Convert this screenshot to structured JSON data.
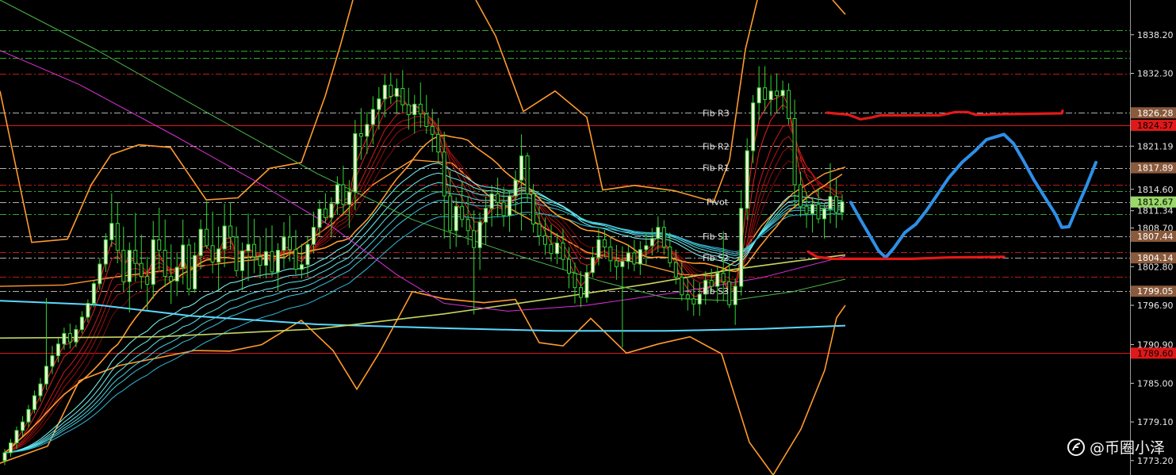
{
  "chart_data": {
    "type": "line",
    "title": "",
    "ylim": [
      1771.0,
      1843.5
    ],
    "y_ticks": [
      "1838.20",
      "1832.30",
      "1826.28",
      "1824.37",
      "1821.19",
      "1817.89",
      "1814.60",
      "1812.67",
      "1811.34",
      "1808.70",
      "1807.44",
      "1804.14",
      "1802.80",
      "1799.05",
      "1796.90",
      "1790.90",
      "1789.60",
      "1785.00",
      "1779.10",
      "1773.20"
    ],
    "price_tags": [
      {
        "label": "1826.28",
        "value": 1826.28,
        "bg": "#8a5a3c",
        "fg": "#ffffff"
      },
      {
        "label": "1824.37",
        "value": 1824.37,
        "bg": "#e01818",
        "fg": "#000000"
      },
      {
        "label": "1817.89",
        "value": 1817.89,
        "bg": "#8a5a3c",
        "fg": "#ffffff"
      },
      {
        "label": "1812.67",
        "value": 1812.67,
        "bg": "#9ad86a",
        "fg": "#000000"
      },
      {
        "label": "1807.44",
        "value": 1807.44,
        "bg": "#8a5a3c",
        "fg": "#ffffff"
      },
      {
        "label": "1804.14",
        "value": 1804.14,
        "bg": "#8a5a3c",
        "fg": "#ffffff"
      },
      {
        "label": "1799.05",
        "value": 1799.05,
        "bg": "#8a5a3c",
        "fg": "#ffffff"
      },
      {
        "label": "1789.60",
        "value": 1789.6,
        "bg": "#e01818",
        "fg": "#000000"
      }
    ],
    "fib_levels": [
      {
        "name": "Fib R3",
        "value": 1826.28
      },
      {
        "name": "Fib R2",
        "value": 1821.19
      },
      {
        "name": "Fib R1",
        "value": 1817.89
      },
      {
        "name": "Pivot",
        "value": 1812.67
      },
      {
        "name": "Fib S1",
        "value": 1807.44
      },
      {
        "name": "Fib S2",
        "value": 1804.14
      },
      {
        "name": "Fib S3",
        "value": 1799.05
      }
    ],
    "horizontal_lines": [
      {
        "value": 1838.9,
        "color": "#2fa82f",
        "style": "dashdot"
      },
      {
        "value": 1835.8,
        "color": "#2fa82f",
        "style": "dashdot"
      },
      {
        "value": 1834.7,
        "color": "#2fa82f",
        "style": "dashdot"
      },
      {
        "value": 1832.3,
        "color": "#c21a1a",
        "style": "dashdot"
      },
      {
        "value": 1826.28,
        "color": "#b0b0b0",
        "style": "dashdot"
      },
      {
        "value": 1824.37,
        "color": "#e01818",
        "style": "solid"
      },
      {
        "value": 1821.19,
        "color": "#b0b0b0",
        "style": "dashdot"
      },
      {
        "value": 1817.89,
        "color": "#b0b0b0",
        "style": "dashdot"
      },
      {
        "value": 1815.3,
        "color": "#c21a1a",
        "style": "dashdot"
      },
      {
        "value": 1814.3,
        "color": "#2fa82f",
        "style": "dashdot"
      },
      {
        "value": 1812.67,
        "color": "#b0b0b0",
        "style": "dashdot"
      },
      {
        "value": 1810.8,
        "color": "#2fa82f",
        "style": "dashdot"
      },
      {
        "value": 1807.44,
        "color": "#b0b0b0",
        "style": "dashdot"
      },
      {
        "value": 1805.0,
        "color": "#c21a1a",
        "style": "dashdot"
      },
      {
        "value": 1804.14,
        "color": "#b0b0b0",
        "style": "dashdot"
      },
      {
        "value": 1801.3,
        "color": "#c21a1a",
        "style": "dashdot"
      },
      {
        "value": 1799.05,
        "color": "#b0b0b0",
        "style": "dashdot"
      },
      {
        "value": 1789.6,
        "color": "#e01818",
        "style": "solid"
      }
    ],
    "candles": [
      [
        1773.2,
        1775.0,
        1772.5,
        1774.4
      ],
      [
        1774.4,
        1776.5,
        1773.8,
        1775.9
      ],
      [
        1775.9,
        1778.4,
        1775.0,
        1777.8
      ],
      [
        1777.8,
        1780.0,
        1776.9,
        1779.1
      ],
      [
        1779.1,
        1781.7,
        1778.3,
        1781.0
      ],
      [
        1781.0,
        1783.9,
        1780.4,
        1783.1
      ],
      [
        1783.1,
        1785.8,
        1782.2,
        1784.9
      ],
      [
        1784.9,
        1798.0,
        1784.0,
        1787.6
      ],
      [
        1787.6,
        1790.7,
        1786.4,
        1789.2
      ],
      [
        1789.2,
        1791.9,
        1788.2,
        1791.0
      ],
      [
        1791.0,
        1793.5,
        1790.1,
        1792.6
      ],
      [
        1792.6,
        1794.1,
        1790.3,
        1791.3
      ],
      [
        1791.3,
        1793.9,
        1790.5,
        1793.2
      ],
      [
        1793.2,
        1796.0,
        1792.6,
        1795.1
      ],
      [
        1795.1,
        1797.8,
        1794.3,
        1797.2
      ],
      [
        1797.2,
        1800.7,
        1796.6,
        1800.2
      ],
      [
        1800.2,
        1804.1,
        1799.3,
        1803.2
      ],
      [
        1803.2,
        1807.9,
        1802.0,
        1806.9
      ],
      [
        1806.9,
        1814.0,
        1805.8,
        1809.4
      ],
      [
        1809.4,
        1812.6,
        1803.3,
        1805.3
      ],
      [
        1805.3,
        1808.9,
        1799.0,
        1800.5
      ],
      [
        1800.5,
        1806.5,
        1795.8,
        1805.3
      ],
      [
        1805.3,
        1811.0,
        1800.5,
        1803.3
      ],
      [
        1803.3,
        1807.7,
        1799.4,
        1801.3
      ],
      [
        1801.3,
        1804.3,
        1796.2,
        1800.1
      ],
      [
        1800.1,
        1809.8,
        1797.9,
        1806.9
      ],
      [
        1806.9,
        1811.8,
        1802.3,
        1805.3
      ],
      [
        1805.3,
        1810.0,
        1799.7,
        1801.3
      ],
      [
        1801.3,
        1806.2,
        1797.1,
        1800.6
      ],
      [
        1800.6,
        1805.0,
        1798.3,
        1802.7
      ],
      [
        1802.7,
        1810.0,
        1800.1,
        1806.1
      ],
      [
        1806.1,
        1807.1,
        1798.4,
        1799.4
      ],
      [
        1799.4,
        1806.5,
        1798.8,
        1804.5
      ],
      [
        1804.5,
        1810.0,
        1802.4,
        1808.5
      ],
      [
        1808.5,
        1812.8,
        1805.5,
        1806.0
      ],
      [
        1806.0,
        1811.2,
        1801.8,
        1803.5
      ],
      [
        1803.5,
        1808.9,
        1799.0,
        1805.5
      ],
      [
        1805.5,
        1812.4,
        1802.7,
        1809.0
      ],
      [
        1809.0,
        1812.6,
        1805.4,
        1807.3
      ],
      [
        1807.3,
        1808.9,
        1801.3,
        1802.2
      ],
      [
        1802.2,
        1806.5,
        1799.2,
        1805.2
      ],
      [
        1805.2,
        1810.9,
        1800.6,
        1806.2
      ],
      [
        1806.2,
        1810.1,
        1801.8,
        1804.3
      ],
      [
        1804.3,
        1807.3,
        1801.0,
        1803.0
      ],
      [
        1803.0,
        1808.7,
        1801.0,
        1805.1
      ],
      [
        1805.1,
        1809.1,
        1801.3,
        1802.0
      ],
      [
        1802.0,
        1806.4,
        1799.0,
        1805.3
      ],
      [
        1805.3,
        1809.6,
        1802.5,
        1807.3
      ],
      [
        1807.3,
        1810.6,
        1803.6,
        1805.4
      ],
      [
        1805.4,
        1808.4,
        1801.6,
        1802.4
      ],
      [
        1802.4,
        1806.3,
        1801.0,
        1803.1
      ],
      [
        1803.1,
        1807.5,
        1801.2,
        1806.2
      ],
      [
        1806.2,
        1811.2,
        1804.8,
        1808.8
      ],
      [
        1808.8,
        1813.0,
        1807.4,
        1811.6
      ],
      [
        1811.6,
        1814.0,
        1809.4,
        1810.3
      ],
      [
        1810.3,
        1813.4,
        1807.4,
        1812.4
      ],
      [
        1812.4,
        1816.6,
        1810.7,
        1815.3
      ],
      [
        1815.3,
        1818.2,
        1810.8,
        1812.3
      ],
      [
        1812.3,
        1816.0,
        1808.7,
        1814.2
      ],
      [
        1814.2,
        1825.2,
        1811.4,
        1823.1
      ],
      [
        1823.1,
        1827.0,
        1819.1,
        1822.7
      ],
      [
        1822.7,
        1826.4,
        1820.0,
        1824.5
      ],
      [
        1824.5,
        1828.8,
        1821.5,
        1826.8
      ],
      [
        1826.8,
        1830.2,
        1823.7,
        1828.4
      ],
      [
        1828.4,
        1832.1,
        1825.6,
        1830.5
      ],
      [
        1830.5,
        1832.4,
        1827.6,
        1828.8
      ],
      [
        1828.8,
        1831.5,
        1826.1,
        1830.0
      ],
      [
        1830.0,
        1832.8,
        1826.4,
        1827.5
      ],
      [
        1827.5,
        1830.1,
        1823.7,
        1826.0
      ],
      [
        1826.0,
        1829.0,
        1823.1,
        1827.6
      ],
      [
        1827.6,
        1830.9,
        1824.0,
        1826.1
      ],
      [
        1826.1,
        1829.0,
        1823.1,
        1824.2
      ],
      [
        1824.2,
        1826.9,
        1820.3,
        1823.0
      ],
      [
        1823.0,
        1825.5,
        1818.8,
        1820.3
      ],
      [
        1820.3,
        1823.4,
        1807.1,
        1813.6
      ],
      [
        1813.6,
        1817.4,
        1805.5,
        1808.3
      ],
      [
        1808.3,
        1813.4,
        1805.8,
        1812.0
      ],
      [
        1812.0,
        1815.8,
        1808.8,
        1810.0
      ],
      [
        1810.0,
        1813.6,
        1806.1,
        1808.3
      ],
      [
        1808.3,
        1811.4,
        1795.5,
        1805.7
      ],
      [
        1805.7,
        1811.1,
        1802.3,
        1809.6
      ],
      [
        1809.6,
        1813.5,
        1806.1,
        1811.7
      ],
      [
        1811.7,
        1815.2,
        1808.9,
        1813.9
      ],
      [
        1813.9,
        1816.4,
        1810.3,
        1812.6
      ],
      [
        1812.6,
        1815.0,
        1808.9,
        1810.6
      ],
      [
        1810.6,
        1814.5,
        1808.1,
        1813.6
      ],
      [
        1813.6,
        1817.5,
        1810.9,
        1816.0
      ],
      [
        1816.0,
        1823.0,
        1808.3,
        1819.7
      ],
      [
        1819.7,
        1820.2,
        1812.6,
        1813.9
      ],
      [
        1813.9,
        1815.4,
        1808.0,
        1809.3
      ],
      [
        1809.3,
        1812.0,
        1806.0,
        1807.5
      ],
      [
        1807.5,
        1810.3,
        1804.6,
        1806.2
      ],
      [
        1806.2,
        1809.2,
        1803.6,
        1804.8
      ],
      [
        1804.8,
        1807.9,
        1803.2,
        1806.4
      ],
      [
        1806.4,
        1808.6,
        1802.3,
        1803.9
      ],
      [
        1803.9,
        1805.8,
        1799.5,
        1801.8
      ],
      [
        1801.8,
        1803.4,
        1797.2,
        1799.6
      ],
      [
        1799.6,
        1802.1,
        1796.6,
        1798.1
      ],
      [
        1798.1,
        1803.1,
        1797.3,
        1801.9
      ],
      [
        1801.9,
        1805.8,
        1801.2,
        1804.2
      ],
      [
        1804.2,
        1808.6,
        1803.0,
        1806.9
      ],
      [
        1806.9,
        1808.4,
        1804.2,
        1805.8
      ],
      [
        1805.8,
        1807.3,
        1802.0,
        1803.7
      ],
      [
        1803.7,
        1806.1,
        1800.8,
        1802.8
      ],
      [
        1802.8,
        1805.9,
        1790.5,
        1803.6
      ],
      [
        1803.6,
        1806.2,
        1802.4,
        1804.9
      ],
      [
        1804.9,
        1806.9,
        1802.1,
        1803.2
      ],
      [
        1803.2,
        1806.7,
        1801.5,
        1805.4
      ],
      [
        1805.4,
        1808.0,
        1803.0,
        1806.0
      ],
      [
        1806.0,
        1808.7,
        1804.5,
        1807.1
      ],
      [
        1807.1,
        1810.5,
        1805.0,
        1808.8
      ],
      [
        1808.8,
        1809.9,
        1804.6,
        1805.8
      ],
      [
        1805.8,
        1808.0,
        1802.7,
        1803.4
      ],
      [
        1803.4,
        1805.4,
        1800.1,
        1801.2
      ],
      [
        1801.2,
        1803.6,
        1797.6,
        1798.5
      ],
      [
        1798.5,
        1801.0,
        1796.1,
        1797.9
      ],
      [
        1797.9,
        1800.8,
        1795.3,
        1797.1
      ],
      [
        1797.1,
        1800.3,
        1795.3,
        1798.6
      ],
      [
        1798.6,
        1802.1,
        1797.0,
        1800.7
      ],
      [
        1800.7,
        1802.5,
        1798.9,
        1799.8
      ],
      [
        1799.8,
        1803.0,
        1797.3,
        1801.8
      ],
      [
        1801.8,
        1808.2,
        1797.6,
        1800.5
      ],
      [
        1800.5,
        1803.3,
        1796.5,
        1797.0
      ],
      [
        1797.0,
        1801.0,
        1793.9,
        1799.8
      ],
      [
        1799.8,
        1814.5,
        1798.4,
        1811.7
      ],
      [
        1811.7,
        1822.4,
        1809.9,
        1820.5
      ],
      [
        1820.5,
        1829.0,
        1818.6,
        1827.8
      ],
      [
        1827.8,
        1833.4,
        1825.2,
        1830.1
      ],
      [
        1830.1,
        1833.4,
        1826.5,
        1828.3
      ],
      [
        1828.3,
        1832.0,
        1825.8,
        1829.6
      ],
      [
        1829.6,
        1832.3,
        1826.3,
        1828.9
      ],
      [
        1828.9,
        1831.2,
        1826.7,
        1829.7
      ],
      [
        1829.7,
        1830.8,
        1824.5,
        1825.4
      ],
      [
        1825.4,
        1828.3,
        1812.0,
        1815.3
      ],
      [
        1815.3,
        1817.3,
        1810.4,
        1812.0
      ],
      [
        1812.0,
        1814.3,
        1808.7,
        1810.9
      ],
      [
        1810.9,
        1813.4,
        1808.0,
        1812.3
      ],
      [
        1812.3,
        1814.8,
        1809.4,
        1810.1
      ],
      [
        1810.1,
        1812.5,
        1807.1,
        1811.6
      ],
      [
        1811.6,
        1818.6,
        1809.4,
        1813.5
      ],
      [
        1813.5,
        1816.2,
        1808.7,
        1811.1
      ],
      [
        1811.1,
        1813.8,
        1809.9,
        1812.7
      ]
    ],
    "forecast_path": [
      [
        1073,
        1812.6
      ],
      [
        1085,
        1810.0
      ],
      [
        1097,
        1807.5
      ],
      [
        1108,
        1805.2
      ],
      [
        1117,
        1804.2
      ],
      [
        1127,
        1805.6
      ],
      [
        1141,
        1808.0
      ],
      [
        1155,
        1809.3
      ],
      [
        1168,
        1811.3
      ],
      [
        1181,
        1813.6
      ],
      [
        1196,
        1816.3
      ],
      [
        1213,
        1818.7
      ],
      [
        1229,
        1820.4
      ],
      [
        1244,
        1822.2
      ],
      [
        1266,
        1823.0
      ],
      [
        1278,
        1821.6
      ],
      [
        1290,
        1819.1
      ],
      [
        1304,
        1816.0
      ],
      [
        1318,
        1813.3
      ],
      [
        1331,
        1810.8
      ],
      [
        1339,
        1808.8
      ],
      [
        1348,
        1808.9
      ],
      [
        1357,
        1811.5
      ],
      [
        1369,
        1814.8
      ],
      [
        1382,
        1818.7
      ]
    ],
    "red_segments": [
      [
        [
          1043,
          1826.3
        ],
        [
          1070,
          1826.0
        ],
        [
          1085,
          1825.3
        ],
        [
          1100,
          1825.6
        ],
        [
          1110,
          1825.9
        ],
        [
          1185,
          1825.9
        ],
        [
          1205,
          1826.4
        ],
        [
          1220,
          1826.4
        ],
        [
          1230,
          1826.0
        ],
        [
          1339,
          1826.2
        ],
        [
          1340,
          1826.6
        ]
      ],
      [
        [
          1019,
          1805.1
        ],
        [
          1030,
          1804.3
        ],
        [
          1050,
          1804.0
        ],
        [
          1150,
          1804.0
        ],
        [
          1195,
          1804.2
        ],
        [
          1266,
          1804.3
        ]
      ]
    ]
  },
  "watermark": {
    "text": "@币圈小泽"
  }
}
